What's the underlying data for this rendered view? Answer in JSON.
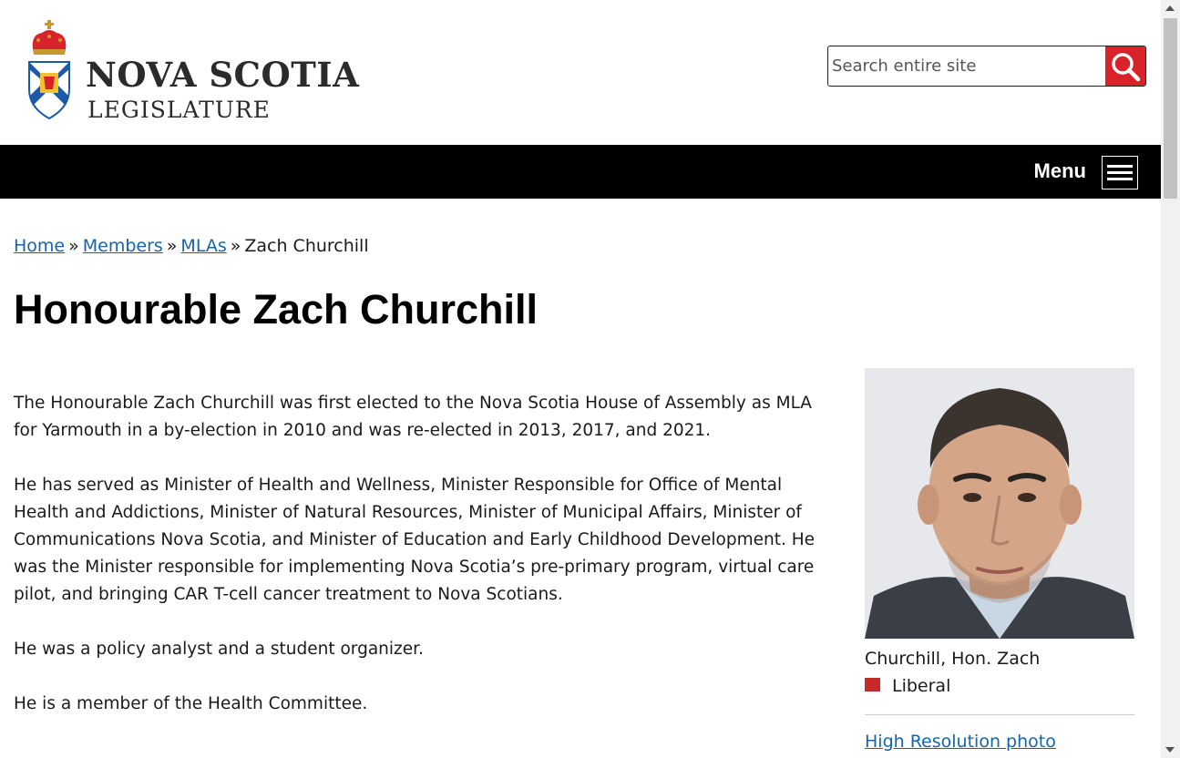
{
  "header": {
    "logo_line1": "NOVA SCOTIA",
    "logo_line2": "LEGISLATURE",
    "search_placeholder": "Search entire site"
  },
  "nav": {
    "menu_label": "Menu"
  },
  "breadcrumb": {
    "items": [
      "Home",
      "Members",
      "MLAs"
    ],
    "separator": "»",
    "current": "Zach Churchill"
  },
  "page_title": "Honourable Zach Churchill",
  "bio": {
    "paragraphs": [
      "The Honourable Zach Churchill was first elected to the Nova Scotia House of Assembly as MLA for Yarmouth in a by-election in 2010 and was re-elected in 2013, 2017, and 2021.",
      "He has served as Minister of Health and Wellness, Minister Responsible for Office of Mental Health and Addictions, Minister of Natural Resources, Minister of Municipal Affairs, Minister of Communications Nova Scotia, and Minister of Education and Early Childhood Development.  He was the Minister responsible for implementing Nova Scotia’s pre-primary program, virtual care pilot, and bringing CAR T-cell cancer treatment to Nova Scotians.",
      "He was a policy analyst and a student organizer.",
      "He is a member of the Health Committee."
    ]
  },
  "sidebar": {
    "caption_name": "Churchill, Hon. Zach",
    "party": "Liberal",
    "party_color": "#c8292b",
    "hires_link": "High Resolution photo"
  },
  "colors": {
    "accent_red": "#d8232a",
    "link_blue": "#1565a8",
    "nav_bg": "#000000"
  }
}
